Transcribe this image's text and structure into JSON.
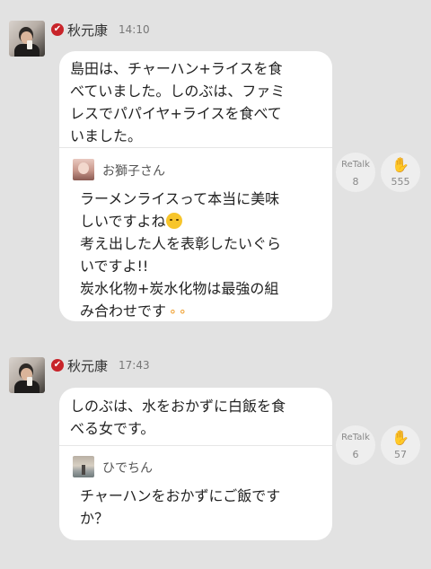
{
  "posts": [
    {
      "author": "秋元康",
      "verified_glyph": "✔",
      "time": "14:10",
      "text": "島田は、チャーハン+ライスを食\nべていました。しのぶは、ファミ\nレスでパパイヤ+ライスを食べて\nいました。",
      "reply": {
        "name": "お獅子さん",
        "text_a": "ラーメンライスって本当に美味\nしいですよね",
        "text_b": "考え出した人を表彰したいぐら\nいですよ!!\n炭水化物+炭水化物は最強の組\nみ合わせです"
      },
      "retalk_label": "ReTalk",
      "retalk_count": "8",
      "clap_count": "555"
    },
    {
      "author": "秋元康",
      "verified_glyph": "✔",
      "time": "17:43",
      "text": "しのぶは、水をおかずに白飯を食\nべる女です。",
      "reply": {
        "name": "ひでちん",
        "text_a": "チャーハンをおかずにご飯です\nか？"
      },
      "retalk_label": "ReTalk",
      "retalk_count": "6",
      "clap_count": "57"
    }
  ],
  "icons": {
    "clap": "clap-icon",
    "verified": "verified-badge-icon"
  },
  "colors": {
    "background": "#e2e2e2",
    "badge": "#c8242a",
    "bubble": "#ffffff"
  }
}
